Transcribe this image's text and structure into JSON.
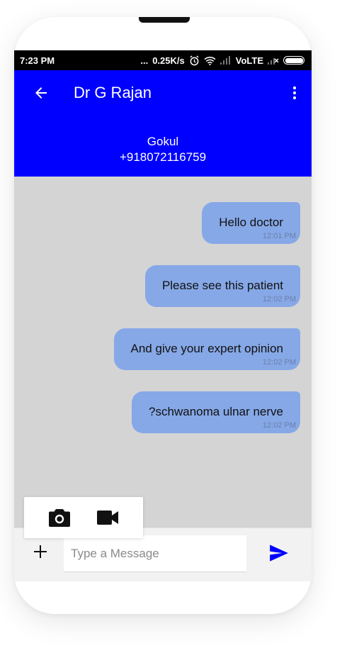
{
  "status_bar": {
    "time": "7:23 PM",
    "dots": "...",
    "network_speed": "0.25K/s",
    "carrier": "VoLTE"
  },
  "header": {
    "title": "Dr G Rajan",
    "patient_name": "Gokul",
    "patient_phone": "+918072116759"
  },
  "messages": [
    {
      "text": "Hello doctor",
      "time": "12:01 PM"
    },
    {
      "text": "Please see this patient",
      "time": "12:02 PM"
    },
    {
      "text": "And give your expert opinion",
      "time": "12:02 PM"
    },
    {
      "text": "?schwanoma ulnar nerve",
      "time": "12:02 PM"
    }
  ],
  "composer": {
    "placeholder": "Type a Message"
  },
  "colors": {
    "app_bar": "#0000ff",
    "bubble": "#86a8e7",
    "send_icon": "#0000ff",
    "chat_background": "#d4d4d4"
  },
  "icons": {
    "back": "arrow-back-icon",
    "more": "more-vert-icon",
    "camera": "camera-icon",
    "video": "videocam-icon",
    "add": "plus-icon",
    "send": "send-icon"
  }
}
